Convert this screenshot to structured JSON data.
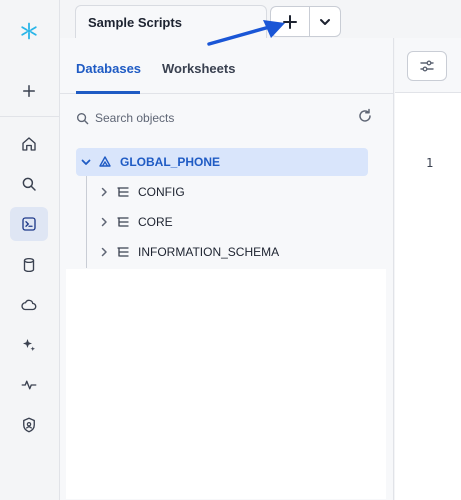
{
  "worksheet_tab": {
    "title": "Sample Scripts"
  },
  "object_panel": {
    "tabs": [
      "Databases",
      "Worksheets"
    ],
    "search_placeholder": "Search objects",
    "tree": [
      {
        "label": "GLOBAL_PHONE",
        "selected": true
      },
      {
        "label": "CONFIG"
      },
      {
        "label": "CORE"
      },
      {
        "label": "INFORMATION_SCHEMA"
      }
    ]
  },
  "editor": {
    "line_number": "1"
  },
  "colors": {
    "accent": "#1f5bc4",
    "arrow": "#1a56d6",
    "selected_bg": "#d9e5fb"
  }
}
